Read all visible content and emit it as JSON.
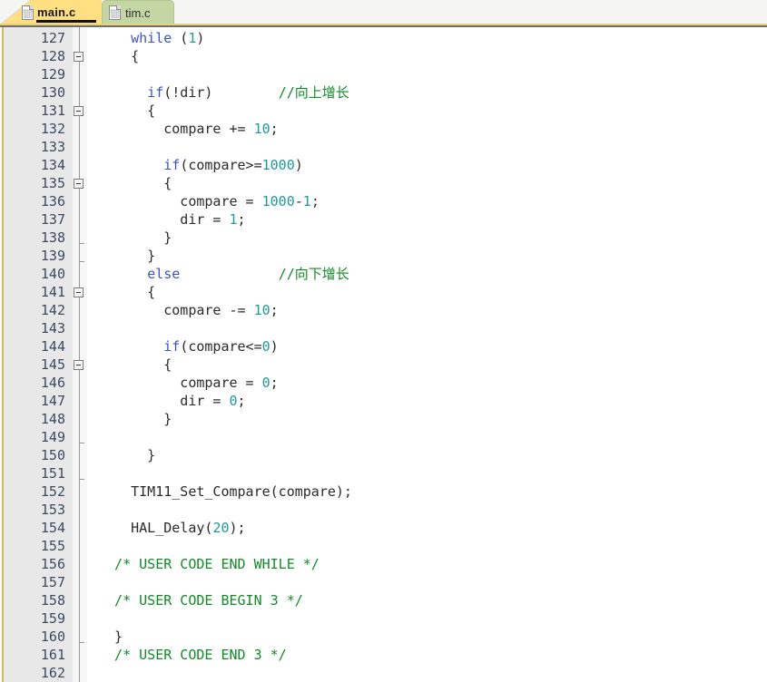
{
  "window": {
    "title": "Code Editor",
    "colors": {
      "active_tab_bg": "#ffdf80",
      "inactive_tab_bg": "#c3d6a4",
      "tabbar_bg": "#f5f5f4",
      "gutter_bg": "#e8e8e8",
      "code_bg": "#ffffff",
      "keyword": "#3b53c8",
      "number": "#1f9a9a",
      "comment": "#128a28",
      "text": "#2b2b2b",
      "linenumber": "#3c4a63",
      "left_accent": "#e3b84a"
    }
  },
  "tabs": [
    {
      "label": "main.c",
      "icon": "file-icon",
      "active": true
    },
    {
      "label": "tim.c",
      "icon": "file-icon",
      "active": false
    }
  ],
  "editor": {
    "first_line_number": 127,
    "last_line_number": 162,
    "language": "c",
    "lines": [
      {
        "n": "127",
        "fold": "none",
        "tokens": [
          {
            "t": "    ",
            "c": "pl"
          },
          {
            "t": "while",
            "c": "kw"
          },
          {
            "t": " (",
            "c": "pl"
          },
          {
            "t": "1",
            "c": "num"
          },
          {
            "t": ")",
            "c": "pl"
          }
        ]
      },
      {
        "n": "128",
        "fold": "box",
        "tokens": [
          {
            "t": "    {",
            "c": "pl"
          }
        ]
      },
      {
        "n": "129",
        "fold": "none",
        "tokens": []
      },
      {
        "n": "130",
        "fold": "none",
        "tokens": [
          {
            "t": "      ",
            "c": "pl"
          },
          {
            "t": "if",
            "c": "kw"
          },
          {
            "t": "(!dir)        ",
            "c": "pl"
          },
          {
            "t": "//向上增长",
            "c": "cmt"
          }
        ]
      },
      {
        "n": "131",
        "fold": "box",
        "tokens": [
          {
            "t": "      {",
            "c": "pl"
          }
        ]
      },
      {
        "n": "132",
        "fold": "none",
        "tokens": [
          {
            "t": "        compare += ",
            "c": "pl"
          },
          {
            "t": "10",
            "c": "num"
          },
          {
            "t": ";",
            "c": "pl"
          }
        ]
      },
      {
        "n": "133",
        "fold": "none",
        "tokens": []
      },
      {
        "n": "134",
        "fold": "none",
        "tokens": [
          {
            "t": "        ",
            "c": "pl"
          },
          {
            "t": "if",
            "c": "kw"
          },
          {
            "t": "(compare>=",
            "c": "pl"
          },
          {
            "t": "1000",
            "c": "num"
          },
          {
            "t": ")",
            "c": "pl"
          }
        ]
      },
      {
        "n": "135",
        "fold": "box",
        "tokens": [
          {
            "t": "        {",
            "c": "pl"
          }
        ]
      },
      {
        "n": "136",
        "fold": "none",
        "tokens": [
          {
            "t": "          compare = ",
            "c": "pl"
          },
          {
            "t": "1000",
            "c": "num"
          },
          {
            "t": "-",
            "c": "pl"
          },
          {
            "t": "1",
            "c": "num"
          },
          {
            "t": ";",
            "c": "pl"
          }
        ]
      },
      {
        "n": "137",
        "fold": "none",
        "tokens": [
          {
            "t": "          dir = ",
            "c": "pl"
          },
          {
            "t": "1",
            "c": "num"
          },
          {
            "t": ";",
            "c": "pl"
          }
        ]
      },
      {
        "n": "138",
        "fold": "tick",
        "tokens": [
          {
            "t": "        }",
            "c": "pl"
          }
        ]
      },
      {
        "n": "139",
        "fold": "tick",
        "tokens": [
          {
            "t": "      }",
            "c": "pl"
          }
        ]
      },
      {
        "n": "140",
        "fold": "none",
        "tokens": [
          {
            "t": "      ",
            "c": "pl"
          },
          {
            "t": "else",
            "c": "kw"
          },
          {
            "t": "            ",
            "c": "pl"
          },
          {
            "t": "//向下增长",
            "c": "cmt"
          }
        ]
      },
      {
        "n": "141",
        "fold": "box",
        "tokens": [
          {
            "t": "      {",
            "c": "pl"
          }
        ]
      },
      {
        "n": "142",
        "fold": "none",
        "tokens": [
          {
            "t": "        compare -= ",
            "c": "pl"
          },
          {
            "t": "10",
            "c": "num"
          },
          {
            "t": ";",
            "c": "pl"
          }
        ]
      },
      {
        "n": "143",
        "fold": "none",
        "tokens": []
      },
      {
        "n": "144",
        "fold": "none",
        "tokens": [
          {
            "t": "        ",
            "c": "pl"
          },
          {
            "t": "if",
            "c": "kw"
          },
          {
            "t": "(compare<=",
            "c": "pl"
          },
          {
            "t": "0",
            "c": "num"
          },
          {
            "t": ")",
            "c": "pl"
          }
        ]
      },
      {
        "n": "145",
        "fold": "box",
        "tokens": [
          {
            "t": "        {",
            "c": "pl"
          }
        ]
      },
      {
        "n": "146",
        "fold": "none",
        "tokens": [
          {
            "t": "          compare = ",
            "c": "pl"
          },
          {
            "t": "0",
            "c": "num"
          },
          {
            "t": ";",
            "c": "pl"
          }
        ]
      },
      {
        "n": "147",
        "fold": "none",
        "tokens": [
          {
            "t": "          dir = ",
            "c": "pl"
          },
          {
            "t": "0",
            "c": "num"
          },
          {
            "t": ";",
            "c": "pl"
          }
        ]
      },
      {
        "n": "148",
        "fold": "none",
        "tokens": [
          {
            "t": "        }",
            "c": "pl"
          }
        ]
      },
      {
        "n": "149",
        "fold": "tick",
        "tokens": []
      },
      {
        "n": "150",
        "fold": "none",
        "tokens": [
          {
            "t": "      }",
            "c": "pl"
          }
        ]
      },
      {
        "n": "151",
        "fold": "tick",
        "tokens": []
      },
      {
        "n": "152",
        "fold": "none",
        "tokens": [
          {
            "t": "    TIM11_Set_Compare(compare);",
            "c": "pl"
          }
        ]
      },
      {
        "n": "153",
        "fold": "none",
        "tokens": []
      },
      {
        "n": "154",
        "fold": "none",
        "tokens": [
          {
            "t": "    HAL_Delay(",
            "c": "pl"
          },
          {
            "t": "20",
            "c": "num"
          },
          {
            "t": ");",
            "c": "pl"
          }
        ]
      },
      {
        "n": "155",
        "fold": "none",
        "tokens": []
      },
      {
        "n": "156",
        "fold": "none",
        "tokens": [
          {
            "t": "  /* USER CODE END WHILE */",
            "c": "cmt"
          }
        ]
      },
      {
        "n": "157",
        "fold": "none",
        "tokens": []
      },
      {
        "n": "158",
        "fold": "none",
        "tokens": [
          {
            "t": "  /* USER CODE BEGIN 3 */",
            "c": "cmt"
          }
        ]
      },
      {
        "n": "159",
        "fold": "none",
        "tokens": []
      },
      {
        "n": "160",
        "fold": "tick",
        "tokens": [
          {
            "t": "  }",
            "c": "pl"
          }
        ]
      },
      {
        "n": "161",
        "fold": "none",
        "tokens": [
          {
            "t": "  /* USER CODE END 3 */",
            "c": "cmt"
          }
        ]
      },
      {
        "n": "162",
        "fold": "none",
        "tokens": []
      }
    ]
  }
}
